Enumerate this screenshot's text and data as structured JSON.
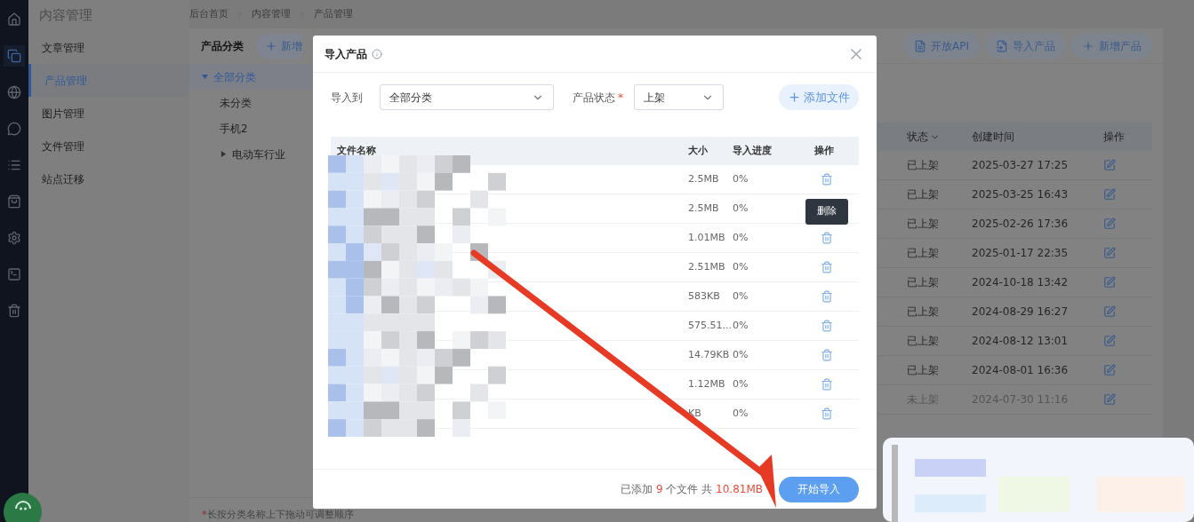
{
  "rail": [
    {
      "kind": "home",
      "selected": false
    },
    {
      "kind": "copy",
      "selected": true
    },
    {
      "kind": "planet",
      "selected": false
    },
    {
      "kind": "chat",
      "selected": false
    },
    {
      "kind": "list",
      "selected": false
    },
    {
      "kind": "bag",
      "selected": false
    },
    {
      "kind": "gear",
      "selected": false
    },
    {
      "kind": "terminal",
      "selected": false
    },
    {
      "kind": "trash",
      "selected": false
    }
  ],
  "sidebar": {
    "title": "内容管理",
    "items": [
      {
        "label": "文章管理",
        "selected": false
      },
      {
        "label": "产品管理",
        "selected": true
      },
      {
        "label": "图片管理",
        "selected": false
      },
      {
        "label": "文件管理",
        "selected": false
      },
      {
        "label": "站点迁移",
        "selected": false
      }
    ]
  },
  "breadcrumb": [
    "后台首页",
    "内容管理",
    "产品管理"
  ],
  "category_panel": {
    "title": "产品分类",
    "add_button": "新增",
    "tree": [
      {
        "label": "全部分类",
        "selected": true,
        "expanded": true,
        "children": [
          {
            "label": "未分类",
            "selected": false
          },
          {
            "label": "手机2",
            "selected": false
          },
          {
            "label": "电动车行业",
            "selected": false,
            "expanded": false
          }
        ]
      }
    ],
    "hint_mark": "*",
    "hint": "长按分类名称上下拖动可调整顺序"
  },
  "toolbar": [
    {
      "kind": "api",
      "label": "开放API"
    },
    {
      "kind": "import",
      "label": "导入产品"
    },
    {
      "kind": "add",
      "label": "新增产品"
    }
  ],
  "product_table": {
    "columns": [
      "状态",
      "创建时间",
      "操作"
    ],
    "rows": [
      {
        "status": "已上架",
        "published": true,
        "created": "2025-03-27 17:25"
      },
      {
        "status": "已上架",
        "published": true,
        "created": "2025-03-25 16:43"
      },
      {
        "status": "已上架",
        "published": true,
        "created": "2025-02-26 17:36"
      },
      {
        "status": "已上架",
        "published": true,
        "created": "2025-01-17 22:35"
      },
      {
        "status": "已上架",
        "published": true,
        "created": "2024-10-18 13:42"
      },
      {
        "status": "已上架",
        "published": true,
        "created": "2024-08-29 16:27"
      },
      {
        "status": "已上架",
        "published": true,
        "created": "2024-08-12 13:01"
      },
      {
        "status": "已上架",
        "published": true,
        "created": "2024-08-01 16:36"
      },
      {
        "status": "未上架",
        "published": false,
        "created": "2024-07-30 11:16"
      }
    ]
  },
  "dialog": {
    "title": "导入产品",
    "target_label": "导入到",
    "target_value": "全部分类",
    "status_label": "产品状态",
    "status_required": true,
    "required_mark": "*",
    "status_value": "上架",
    "add_files_button": "添加文件",
    "columns": [
      "文件名称",
      "大小",
      "导入进度",
      "操作"
    ],
    "files": [
      {
        "size": "2.5MB",
        "progress": "0%"
      },
      {
        "size": "2.5MB",
        "progress": "0%"
      },
      {
        "size": "1.01MB",
        "progress": "0%"
      },
      {
        "size": "2.51MB",
        "progress": "0%"
      },
      {
        "size": "583KB",
        "progress": "0%"
      },
      {
        "size": "575.51...",
        "progress": "0%"
      },
      {
        "size": "14.79KB",
        "progress": "0%"
      },
      {
        "size": "1.12MB",
        "progress": "0%"
      },
      {
        "size": "KB",
        "progress": "0%"
      }
    ],
    "tooltip": "删除",
    "summary": {
      "prefix": "已添加",
      "count": "9",
      "middle": "个文件 共",
      "total": "10.81MB"
    },
    "start_button": "开始导入"
  }
}
